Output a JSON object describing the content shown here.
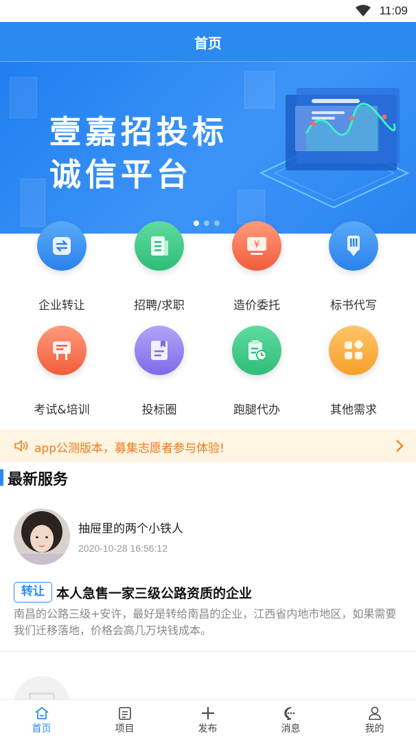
{
  "status_bar": {
    "time": "11:09",
    "wifi_icon": "wifi-icon"
  },
  "header": {
    "title": "首页"
  },
  "banner": {
    "line1": "壹嘉招投标",
    "line2": "诚信平台",
    "slides": 3,
    "active_slide": 1
  },
  "services": [
    {
      "label": "企业转让",
      "icon": "transfer-icon",
      "color_top": "#5aaaf8",
      "color_bottom": "#2a82ec"
    },
    {
      "label": "招聘/求职",
      "icon": "document-icon",
      "color_top": "#5fdba0",
      "color_bottom": "#2fbd78"
    },
    {
      "label": "造价委托",
      "icon": "price-monitor-icon",
      "color_top": "#ff9a7a",
      "color_bottom": "#f25c3c"
    },
    {
      "label": "标书代写",
      "icon": "pen-icon",
      "color_top": "#5aaaf8",
      "color_bottom": "#2a82ec"
    },
    {
      "label": "考试&培训",
      "icon": "blackboard-icon",
      "color_top": "#ff9a7a",
      "color_bottom": "#f25c3c"
    },
    {
      "label": "投标圈",
      "icon": "bookmark-doc-icon",
      "color_top": "#b2a4f7",
      "color_bottom": "#7e6ae8"
    },
    {
      "label": "跑腿代办",
      "icon": "clipboard-clock-icon",
      "color_top": "#5fdba0",
      "color_bottom": "#2fbd78"
    },
    {
      "label": "其他需求",
      "icon": "apps-icon",
      "color_top": "#ffc46a",
      "color_bottom": "#f7a02a"
    }
  ],
  "notice": {
    "text": "app公测版本，募集志愿者参与体验!",
    "icon": "speaker-icon",
    "arrow_icon": "chevron-right-icon",
    "color": "#ef7a1a"
  },
  "section": {
    "title": "最新服务"
  },
  "posts": [
    {
      "user": "抽屉里的两个小铁人",
      "time": "2020-10-28 16:56:12",
      "tag": "转让",
      "title": "本人急售一家三级公路资质的企业",
      "description": "南昌的公路三级+安许，最好是转给南昌的企业，江西省内地市地区，如果需要我们迁移落地，价格会高几万块钱成本。"
    }
  ],
  "tabbar": [
    {
      "label": "首页",
      "icon": "home-icon",
      "active": true
    },
    {
      "label": "项目",
      "icon": "list-icon",
      "active": false
    },
    {
      "label": "发布",
      "icon": "plus-icon",
      "active": false
    },
    {
      "label": "消息",
      "icon": "message-icon",
      "active": false
    },
    {
      "label": "我的",
      "icon": "user-icon",
      "active": false
    }
  ],
  "colors": {
    "primary": "#2b8af0",
    "notice_bg": "#fdf4e1"
  }
}
